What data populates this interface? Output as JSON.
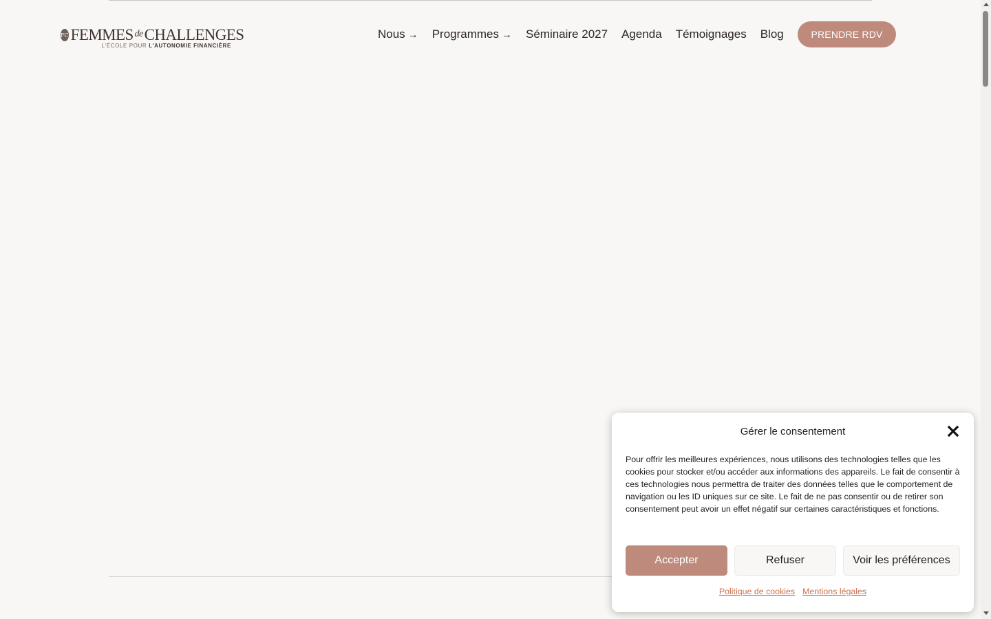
{
  "logo": {
    "mark": "FC",
    "main_left": "FEMMES",
    "main_de": "de",
    "main_right": "CHALLENGES",
    "sub_light": "L'ÉCOLE POUR ",
    "sub_bold": "L'AUTONOMIE FINANCIÈRE"
  },
  "nav": {
    "items": [
      {
        "label": "Nous",
        "arrow": "→"
      },
      {
        "label": "Programmes",
        "arrow": "→"
      },
      {
        "label": "Séminaire 2027"
      },
      {
        "label": "Agenda"
      },
      {
        "label": "Témoignages"
      },
      {
        "label": "Blog"
      }
    ],
    "cta_label": "PRENDRE RDV"
  },
  "consent": {
    "title": "Gérer le consentement",
    "body": "Pour offrir les meilleures expériences, nous utilisons des technologies telles que les cookies pour stocker et/ou accéder aux informations des appareils. Le fait de consentir à ces technologies nous permettra de traiter des données telles que le comportement de navigation ou les ID uniques sur ce site. Le fait de ne pas consentir ou de retirer son consentement peut avoir un effet négatif sur certaines caractéristiques et fonctions.",
    "accept_label": "Accepter",
    "refuse_label": "Refuser",
    "prefs_label": "Voir les préférences",
    "cookie_policy_label": "Politique de cookies",
    "legal_label": "Mentions légales"
  },
  "colors": {
    "accent": "#bd8a7b",
    "background": "#f9f7f5",
    "link": "#c8724e"
  }
}
